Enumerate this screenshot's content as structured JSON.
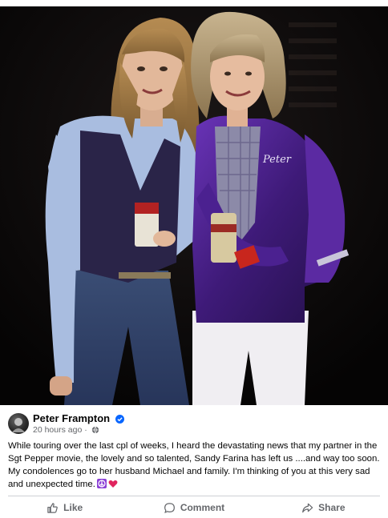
{
  "post": {
    "author": "Peter Frampton",
    "verified_icon": "verified-badge-icon",
    "timestamp": "20 hours ago",
    "separator": " · ",
    "audience_icon": "globe-icon",
    "text": "While touring over the last cpl of weeks, I heard the devastating news that my partner in the Sgt Pepper movie, the lovely and so talented, Sandy Farina has left us ....and way too soon. My condolences go to her husband Michael and family. I'm thinking of you at this very sad and unexpected time.",
    "emojis": [
      "peace-icon",
      "red-heart-icon"
    ],
    "photo": {
      "jacket_lettering": "Peter"
    }
  },
  "actions": {
    "like_label": "Like",
    "comment_label": "Comment",
    "share_label": "Share"
  },
  "colors": {
    "verified_blue": "#0866ff",
    "action_gray": "#65676b",
    "jacket_purple": "#4b1f86",
    "heart_red": "#e0245e",
    "peace_purple": "#8b3fd6"
  }
}
